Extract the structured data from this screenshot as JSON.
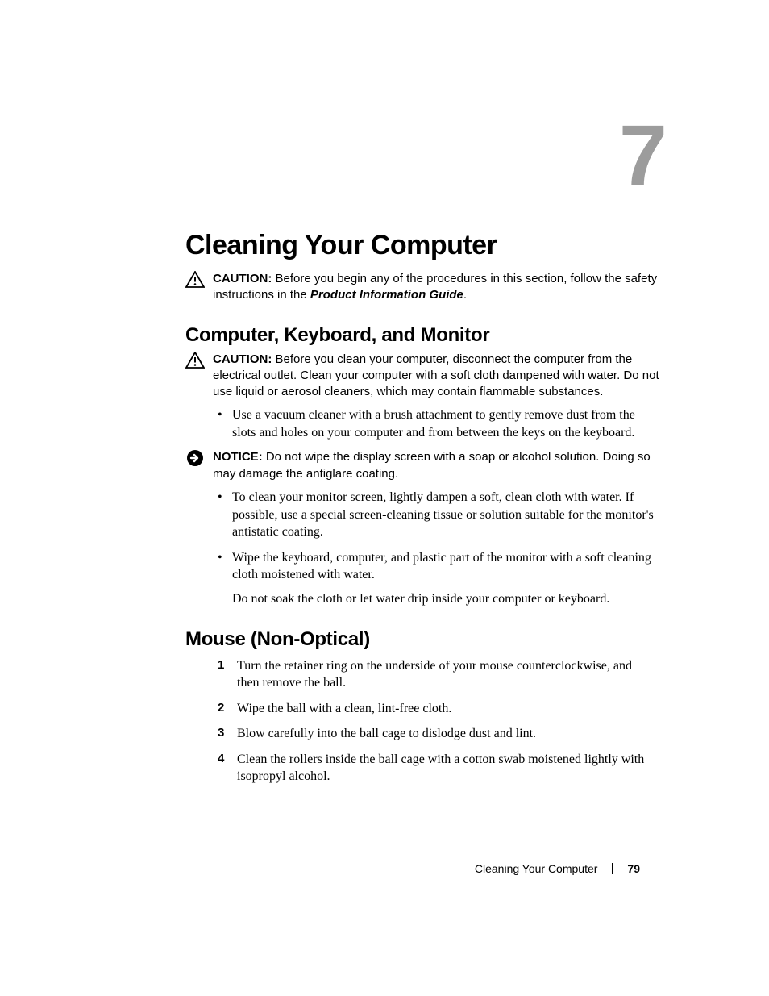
{
  "chapter": {
    "number": "7",
    "title": "Cleaning Your Computer"
  },
  "caution1": {
    "label": "CAUTION:",
    "text": " Before you begin any of the procedures in this section, follow the safety instructions in the ",
    "ital": "Product Information Guide",
    "tail": "."
  },
  "section1": {
    "title": "Computer, Keyboard, and Monitor",
    "caution": {
      "label": "CAUTION:",
      "text": " Before you clean your computer, disconnect the computer from the electrical outlet. Clean your computer with a soft cloth dampened with water. Do not use liquid or aerosol cleaners, which may contain flammable substances."
    },
    "bullets1": [
      "Use a vacuum cleaner with a brush attachment to gently remove dust from the slots and holes on your computer and from between the keys on the keyboard."
    ],
    "notice": {
      "label": "NOTICE:",
      "text": " Do not wipe the display screen with a soap or alcohol solution. Doing so may damage the antiglare coating."
    },
    "bullets2": [
      "To clean your monitor screen, lightly dampen a soft, clean cloth with water. If possible, use a special screen-cleaning tissue or solution suitable for the monitor's antistatic coating.",
      "Wipe the keyboard, computer, and plastic part of the monitor with a soft cleaning cloth moistened with water."
    ],
    "subpara": "Do not soak the cloth or let water drip inside your computer or keyboard."
  },
  "section2": {
    "title": "Mouse (Non-Optical)",
    "steps": [
      "Turn the retainer ring on the underside of your mouse counterclockwise, and then remove the ball.",
      "Wipe the ball with a clean, lint-free cloth.",
      "Blow carefully into the ball cage to dislodge dust and lint.",
      "Clean the rollers inside the ball cage with a cotton swab moistened lightly with isopropyl alcohol."
    ],
    "nums": [
      "1",
      "2",
      "3",
      "4"
    ]
  },
  "footer": {
    "text": "Cleaning Your Computer",
    "page": "79"
  }
}
